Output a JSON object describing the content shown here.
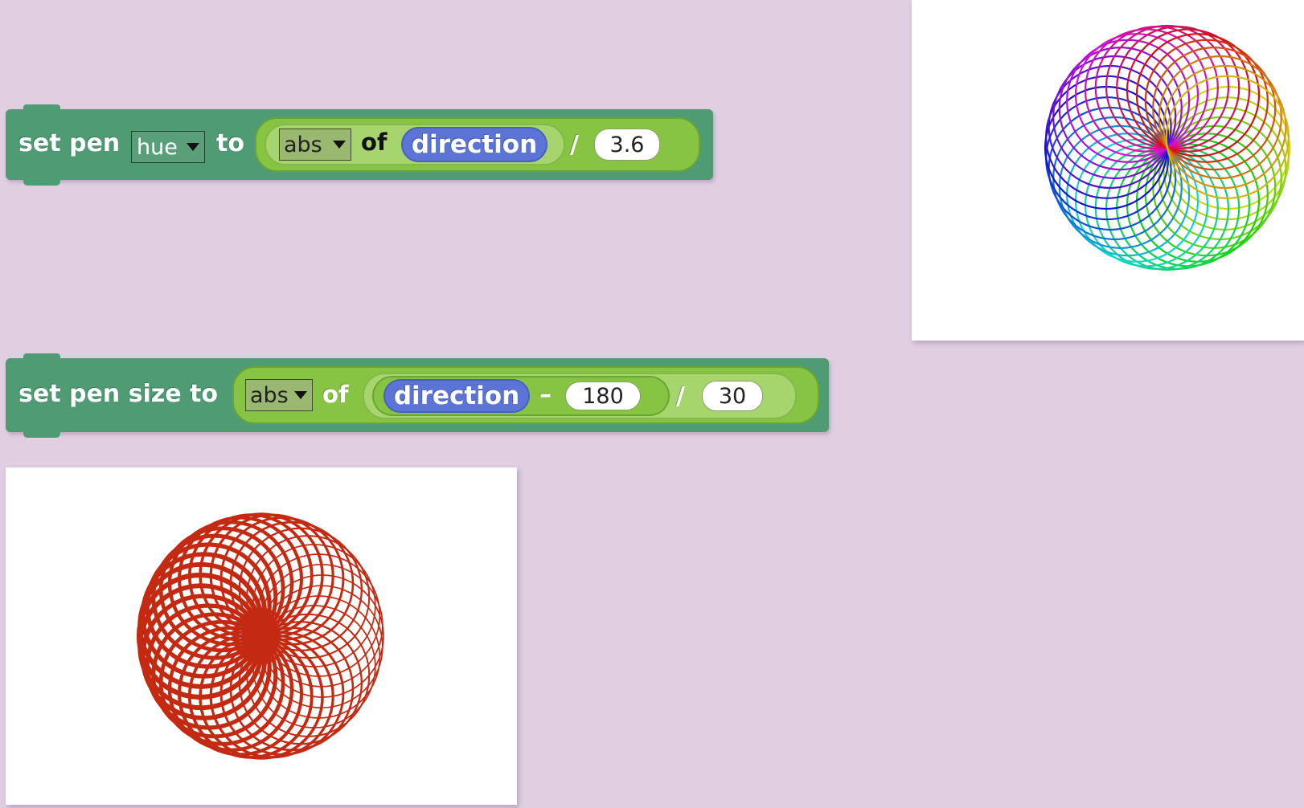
{
  "block_hue": {
    "prefix": "set pen",
    "property": "hue",
    "to_label": "to",
    "function": "abs",
    "of_label": "of",
    "variable": "direction",
    "operator": "/",
    "divisor": "3.6"
  },
  "block_size": {
    "prefix": "set pen size to",
    "function": "abs",
    "of_label": "of",
    "variable": "direction",
    "minus_operator": "–",
    "subtrahend": "180",
    "divide_operator": "/",
    "divisor": "30"
  },
  "stage_rainbow": {
    "style": "rainbow spirograph",
    "ring_count": 36
  },
  "stage_red": {
    "style": "red spirograph",
    "ring_count": 36,
    "color": "#c42a12"
  },
  "colors": {
    "background": "#dfcfe1",
    "pen_block": "#4e9b74",
    "operator_block": "#87c443",
    "variable_block": "#5b74d6",
    "red_pen": "#c42a12"
  }
}
